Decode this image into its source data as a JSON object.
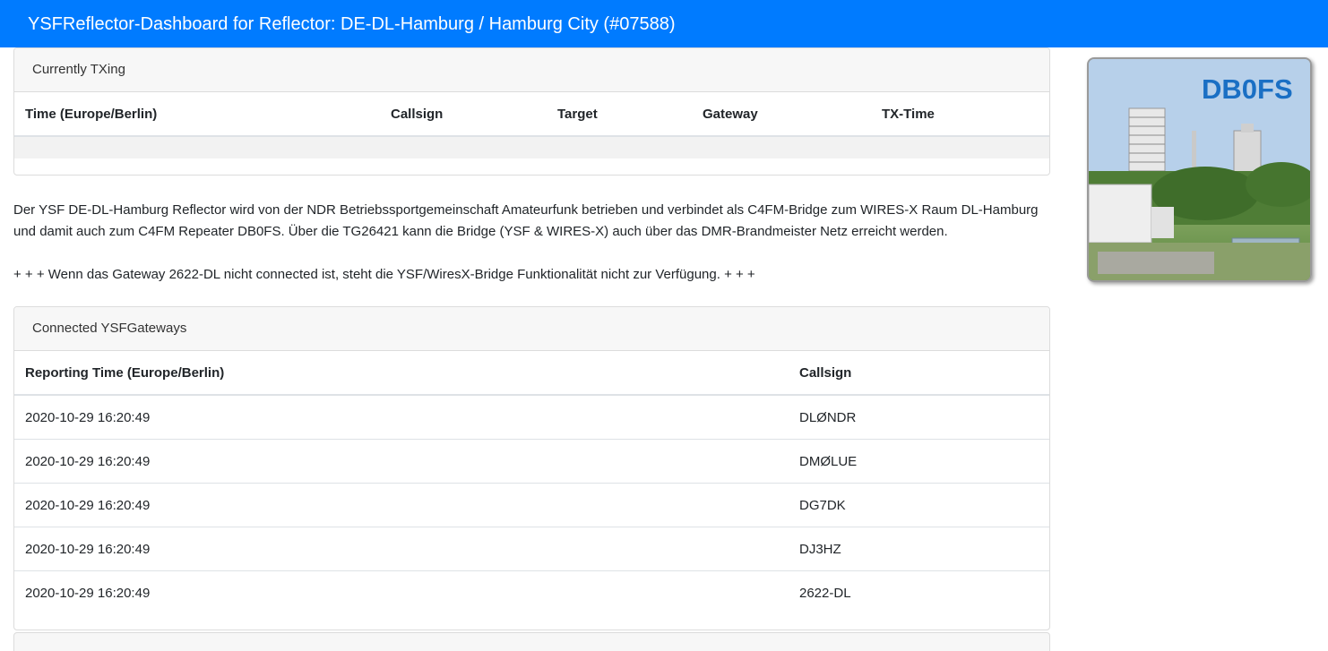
{
  "navbar": {
    "title": "YSFReflector-Dashboard for Reflector: DE-DL-Hamburg / Hamburg City (#07588)"
  },
  "currently_txing": {
    "header": "Currently TXing",
    "columns": [
      "Time (Europe/Berlin)",
      "Callsign",
      "Target",
      "Gateway",
      "TX-Time"
    ],
    "rows": []
  },
  "info": {
    "description": "Der YSF DE-DL-Hamburg Reflector wird von der NDR Betriebssportgemeinschaft Amateurfunk betrieben und verbindet als C4FM-Bridge zum WIRES-X Raum DL-Hamburg und damit auch zum C4FM Repeater DB0FS. Über die TG26421 kann die Bridge (YSF & WIRES-X) auch über das DMR-Brandmeister Netz erreicht werden.",
    "warning": "+ + + Wenn das Gateway 2622-DL nicht connected ist, steht die YSF/WiresX-Bridge Funktionalität nicht zur Verfügung. + + +"
  },
  "gateways": {
    "header": "Connected YSFGateways",
    "columns": [
      "Reporting Time (Europe/Berlin)",
      "Callsign"
    ],
    "rows": [
      {
        "time": "2020-10-29 16:20:49",
        "callsign": "DLØNDR"
      },
      {
        "time": "2020-10-29 16:20:49",
        "callsign": "DMØLUE"
      },
      {
        "time": "2020-10-29 16:20:49",
        "callsign": "DG7DK"
      },
      {
        "time": "2020-10-29 16:20:49",
        "callsign": "DJ3HZ"
      },
      {
        "time": "2020-10-29 16:20:49",
        "callsign": "2622-DL"
      }
    ]
  },
  "logo": {
    "text": "DB0FS",
    "text_color": "#1a6fc4"
  },
  "colors": {
    "navbar": "#007bff",
    "card_header": "#f7f7f7"
  }
}
